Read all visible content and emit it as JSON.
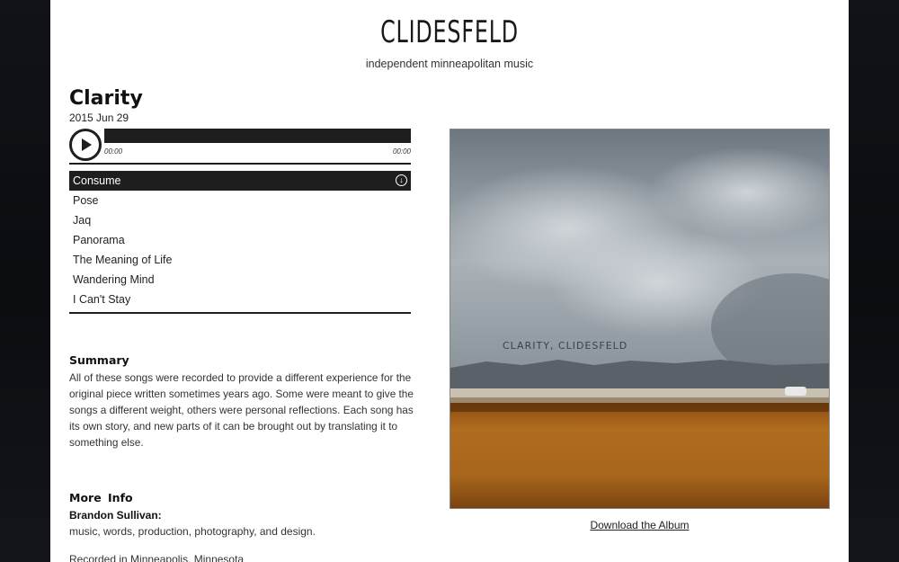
{
  "site": {
    "title": "CLIDESFELD",
    "subtitle": "independent minneapolitan music"
  },
  "album": {
    "title": "Clarity",
    "date": "2015 Jun 29",
    "cover_caption": "CLARITY, CLIDESFELD",
    "download_label": "Download the Album"
  },
  "player": {
    "current_time": "00:00",
    "duration": "00:00",
    "progress": 0
  },
  "tracks": [
    {
      "title": "Consume",
      "active": true
    },
    {
      "title": "Pose",
      "active": false
    },
    {
      "title": "Jaq",
      "active": false
    },
    {
      "title": "Panorama",
      "active": false
    },
    {
      "title": "The Meaning of Life",
      "active": false
    },
    {
      "title": "Wandering Mind",
      "active": false
    },
    {
      "title": "I Can't Stay",
      "active": false
    }
  ],
  "summary": {
    "heading": "Summary",
    "text": "All of these songs were recorded to provide a different experience for the original piece written sometimes years ago. Some were meant to give the songs a different weight, others were personal reflections. Each song has its own story, and new parts of it can be brought out by translating it to something else."
  },
  "more_info": {
    "heading": "More  Info",
    "credit_name": "Brandon Sullivan:",
    "credit_role": "music, words, production, photography, and design.",
    "recorded": "Recorded in Minneapolis, Minnesota"
  },
  "icons": {
    "play": "play-icon",
    "download": "download-icon"
  },
  "colors": {
    "player_dark": "#1e1e1e",
    "page_bg": "#ffffff",
    "outer_bg": "#0d0f14"
  }
}
